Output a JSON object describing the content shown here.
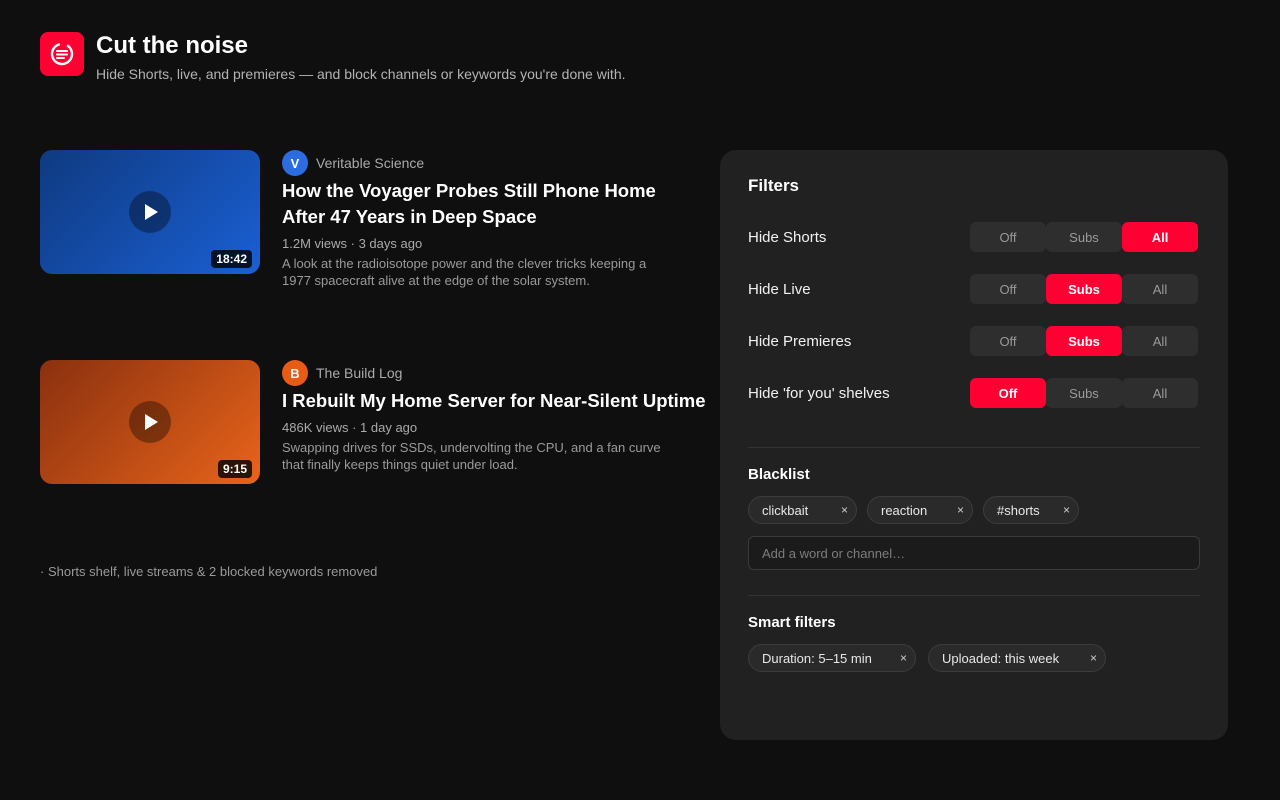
{
  "header": {
    "title": "Cut the noise",
    "subtitle": "Hide Shorts, live, and premieres — and block channels or keywords you're done with.",
    "logo_icon": "filter-logo-icon"
  },
  "videos": [
    {
      "channel_initial": "V",
      "channel": "Veritable Science",
      "title_line1": "How the Voyager Probes Still Phone Home",
      "title_line2": "After 47 Years in Deep Space",
      "stats": "1.2M views · 3 days ago",
      "desc_line1": "A look at the radioisotope power and the clever tricks keeping a",
      "desc_line2": "1977 spacecraft alive at the edge of the solar system.",
      "duration": "18:42"
    },
    {
      "channel_initial": "B",
      "channel": "The Build Log",
      "title_line1": "I Rebuilt My Home Server for Near-Silent Uptime",
      "stats": "486K views · 1 day ago",
      "desc_line1": "Swapping drives for SSDs, undervolting the CPU, and a fan curve",
      "desc_line2": "that finally keeps things quiet under load.",
      "duration": "9:15"
    }
  ],
  "removed_note": "· Shorts shelf, live streams & 2 blocked keywords removed",
  "panel": {
    "title": "Filters",
    "options": [
      "Off",
      "Subs",
      "All"
    ],
    "filters": [
      {
        "label": "Hide Shorts",
        "selected": "All"
      },
      {
        "label": "Hide Live",
        "selected": "Subs"
      },
      {
        "label": "Hide Premieres",
        "selected": "Subs"
      },
      {
        "label": "Hide 'for you' shelves",
        "selected": "Off"
      }
    ],
    "blacklist_title": "Blacklist",
    "blacklist": [
      "clickbait",
      "reaction",
      "#shorts"
    ],
    "add_placeholder": "Add a word or channel…",
    "smart_title": "Smart filters",
    "smart": [
      "Duration: 5–15 min",
      "Uploaded: this week"
    ],
    "remove_glyph": "×"
  },
  "colors": {
    "accent": "#ff0033",
    "background": "#0f0f0f",
    "panel": "#212121"
  }
}
